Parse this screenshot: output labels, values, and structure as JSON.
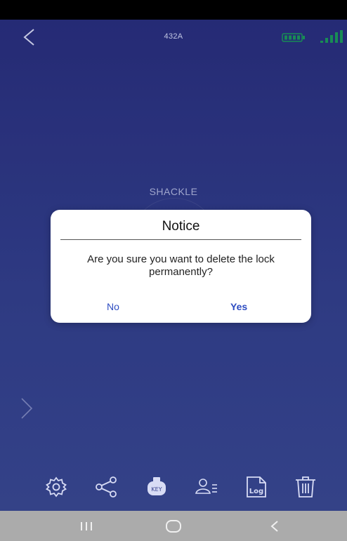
{
  "header": {
    "lock_name": "432A",
    "back_icon": "chevron-left-icon",
    "battery_icon": "battery-icon",
    "signal_icon": "signal-strength-icon"
  },
  "main": {
    "state_label": "SHACKLE",
    "side_arrow_icon": "chevron-right-icon"
  },
  "dialog": {
    "title": "Notice",
    "message": "Are you sure you want to delete the lock permanently?",
    "no_label": "No",
    "yes_label": "Yes"
  },
  "toolbar": {
    "items": [
      {
        "icon": "gear-icon"
      },
      {
        "icon": "share-icon"
      },
      {
        "icon": "key-fob-icon",
        "text": "KEY"
      },
      {
        "icon": "users-icon"
      },
      {
        "icon": "log-icon",
        "text": "Log"
      },
      {
        "icon": "trash-icon"
      }
    ]
  },
  "colors": {
    "background_top": "#2a2f7f",
    "background_bottom": "#3b4a95",
    "accent_blue": "#2e4dc2",
    "battery_green": "#1aa15a",
    "nav_bar": "#ababab"
  }
}
